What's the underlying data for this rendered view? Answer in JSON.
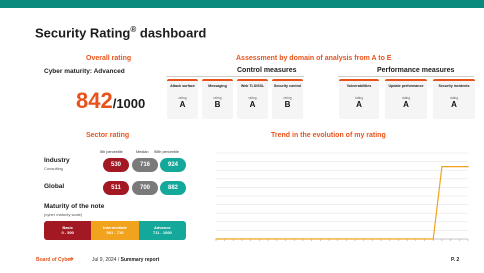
{
  "header": {
    "title": "Security Rating",
    "reg": "®",
    "title_suffix": " dashboard"
  },
  "overall": {
    "heading": "Overall rating",
    "maturity_label": "Cyber maturity: Advanced",
    "score": "842",
    "denom": "/1000"
  },
  "assessment": {
    "heading": "Assessment by domain of analysis from A to E",
    "control_label": "Control measures",
    "performance_label": "Performance measures",
    "rating_word": "rating",
    "domains": [
      {
        "name": "Attack surface",
        "grade": "A"
      },
      {
        "name": "Messaging",
        "grade": "B"
      },
      {
        "name": "Web TLS/SSL",
        "grade": "A"
      },
      {
        "name": "Security control",
        "grade": "B"
      },
      {
        "name": "Vulnerabilities",
        "grade": "A"
      },
      {
        "name": "Update performance",
        "grade": "A"
      },
      {
        "name": "Security incidents",
        "grade": "A"
      }
    ]
  },
  "sector": {
    "heading": "Sector rating",
    "col_5th": "5th percentile",
    "col_median": "Median",
    "col_95th": "95th percentile",
    "rows": [
      {
        "label": "Industry",
        "sub": "Consulting",
        "p5": "530",
        "median": "716",
        "p95": "924"
      },
      {
        "label": "Global",
        "sub": "",
        "p5": "511",
        "median": "700",
        "p95": "882"
      }
    ]
  },
  "maturity": {
    "title": "Maturity of the note",
    "sub": "(cyber maturity scale)",
    "levels": [
      {
        "name": "Basic",
        "range": "0 - 500"
      },
      {
        "name": "Intermediate",
        "range": "501 - 710"
      },
      {
        "name": "Advance",
        "range": "711 - 1000"
      }
    ]
  },
  "trend": {
    "heading": "Trend in the evolution of my rating"
  },
  "chart_data": {
    "type": "line",
    "title": "",
    "xlabel": "",
    "ylabel": "",
    "ylim": [
      0,
      1000
    ],
    "grid": true,
    "x": [
      "1",
      "2",
      "3",
      "4",
      "5",
      "6",
      "7",
      "8",
      "9",
      "10",
      "11",
      "12",
      "13",
      "14",
      "15",
      "16",
      "17",
      "18",
      "19",
      "20",
      "21",
      "22",
      "23",
      "24",
      "25",
      "26",
      "27",
      "28",
      "29",
      "30"
    ],
    "series": [
      {
        "values": [
          0,
          0,
          0,
          0,
          0,
          0,
          0,
          0,
          0,
          0,
          0,
          0,
          0,
          0,
          0,
          0,
          0,
          0,
          0,
          0,
          0,
          0,
          0,
          0,
          0,
          0,
          842,
          842,
          842,
          842
        ]
      }
    ],
    "color": "#f1a31d"
  },
  "footer": {
    "brand": "Board of Cyber",
    "date": "Jul 9, 2024 /",
    "report": " Summary report",
    "page": "P. 2"
  },
  "colors": {
    "accent": "#e8531c",
    "teal": "#0a8a7c",
    "low": "#a31923",
    "median": "#7a7a7a",
    "high": "#14a89a",
    "mid": "#f1a31d"
  }
}
